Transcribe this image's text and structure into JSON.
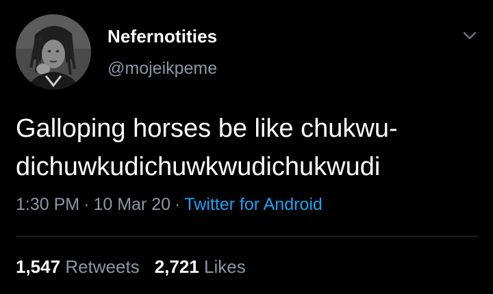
{
  "user": {
    "display_name": "Nefernotities",
    "handle": "@mojeikpeme",
    "avatar_icon": "user-avatar-photo"
  },
  "tweet": {
    "text": "Galloping horses be like chukwu-\ndichuwkudichuwkwudichukwudi",
    "time": "1:30 PM",
    "date": "10 Mar 20",
    "separator": "·",
    "source": "Twitter for Android"
  },
  "stats": {
    "retweets_count": "1,547",
    "retweets_label": "Retweets",
    "likes_count": "2,721",
    "likes_label": "Likes"
  },
  "colors": {
    "background": "#000000",
    "primary_text": "#ffffff",
    "secondary_text": "#8b98a5",
    "link": "#1da1f2",
    "divider": "#2f3336"
  },
  "icons": {
    "menu": "chevron-down-icon"
  }
}
